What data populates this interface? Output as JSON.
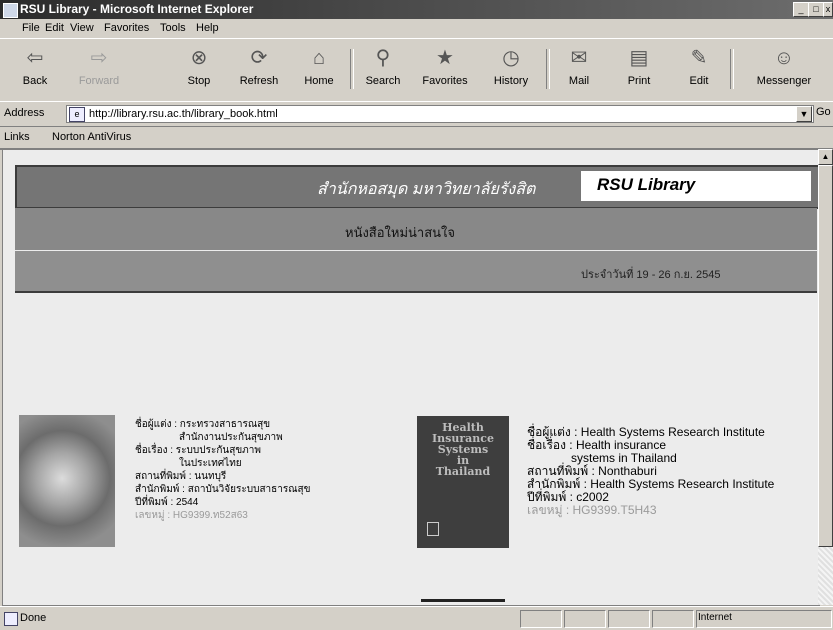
{
  "window": {
    "title": "RSU Library - Microsoft Internet Explorer"
  },
  "menu": [
    "File",
    "Edit",
    "View",
    "Favorites",
    "Tools",
    "Help"
  ],
  "toolbar": {
    "back": "Back",
    "forward": "Forward",
    "stop": "Stop",
    "refresh": "Refresh",
    "home": "Home",
    "search": "Search",
    "favorites": "Favorites",
    "history": "History",
    "mail": "Mail",
    "print": "Print",
    "edit": "Edit",
    "messenger": "Messenger"
  },
  "address": {
    "label": "Address",
    "url": "http://library.rsu.ac.th/library_book.html",
    "go": "Go"
  },
  "links": {
    "label": "Links",
    "norton": "Norton AntiVirus"
  },
  "page": {
    "header_thai": "สำนักหอสมุด มหาวิทยาลัยรังสิต",
    "header_brand": "RSU Library",
    "subtitle_thai": "หนังสือใหม่น่าสนใจ",
    "date_thai": "ประจำวันที่ 19 - 26 ก.ย. 2545"
  },
  "books": [
    {
      "lines": [
        "ชื่อผู้แต่ง : กระทรวงสาธารณสุข",
        "สำนักงานประกันสุขภาพ",
        "ชื่อเรื่อง : ระบบประกันสุขภาพ",
        "ในประเทศไทย",
        "สถานที่พิมพ์ : นนทบุรี",
        "สำนักพิมพ์ : สถาบันวิจัยระบบสาธารณสุข",
        "ปีที่พิมพ์ : 2544"
      ],
      "call": "เลขหมู่ : HG9399.ท52ส63"
    },
    {
      "lines": [
        "ชื่อผู้แต่ง : Health Systems Research Institute",
        "ชื่อเรื่อง : Health insurance",
        "systems in Thailand",
        "สถานที่พิมพ์ : Nonthaburi",
        "สำนักพิมพ์ : Health Systems Research Institute",
        "ปีที่พิมพ์ : c2002"
      ],
      "call": "เลขหมู่ : HG9399.T5H43",
      "cover": [
        "Health",
        "Insurance",
        "Systems",
        "in",
        "Thailand"
      ]
    }
  ],
  "status": {
    "text": "Done",
    "zone": "Internet"
  }
}
